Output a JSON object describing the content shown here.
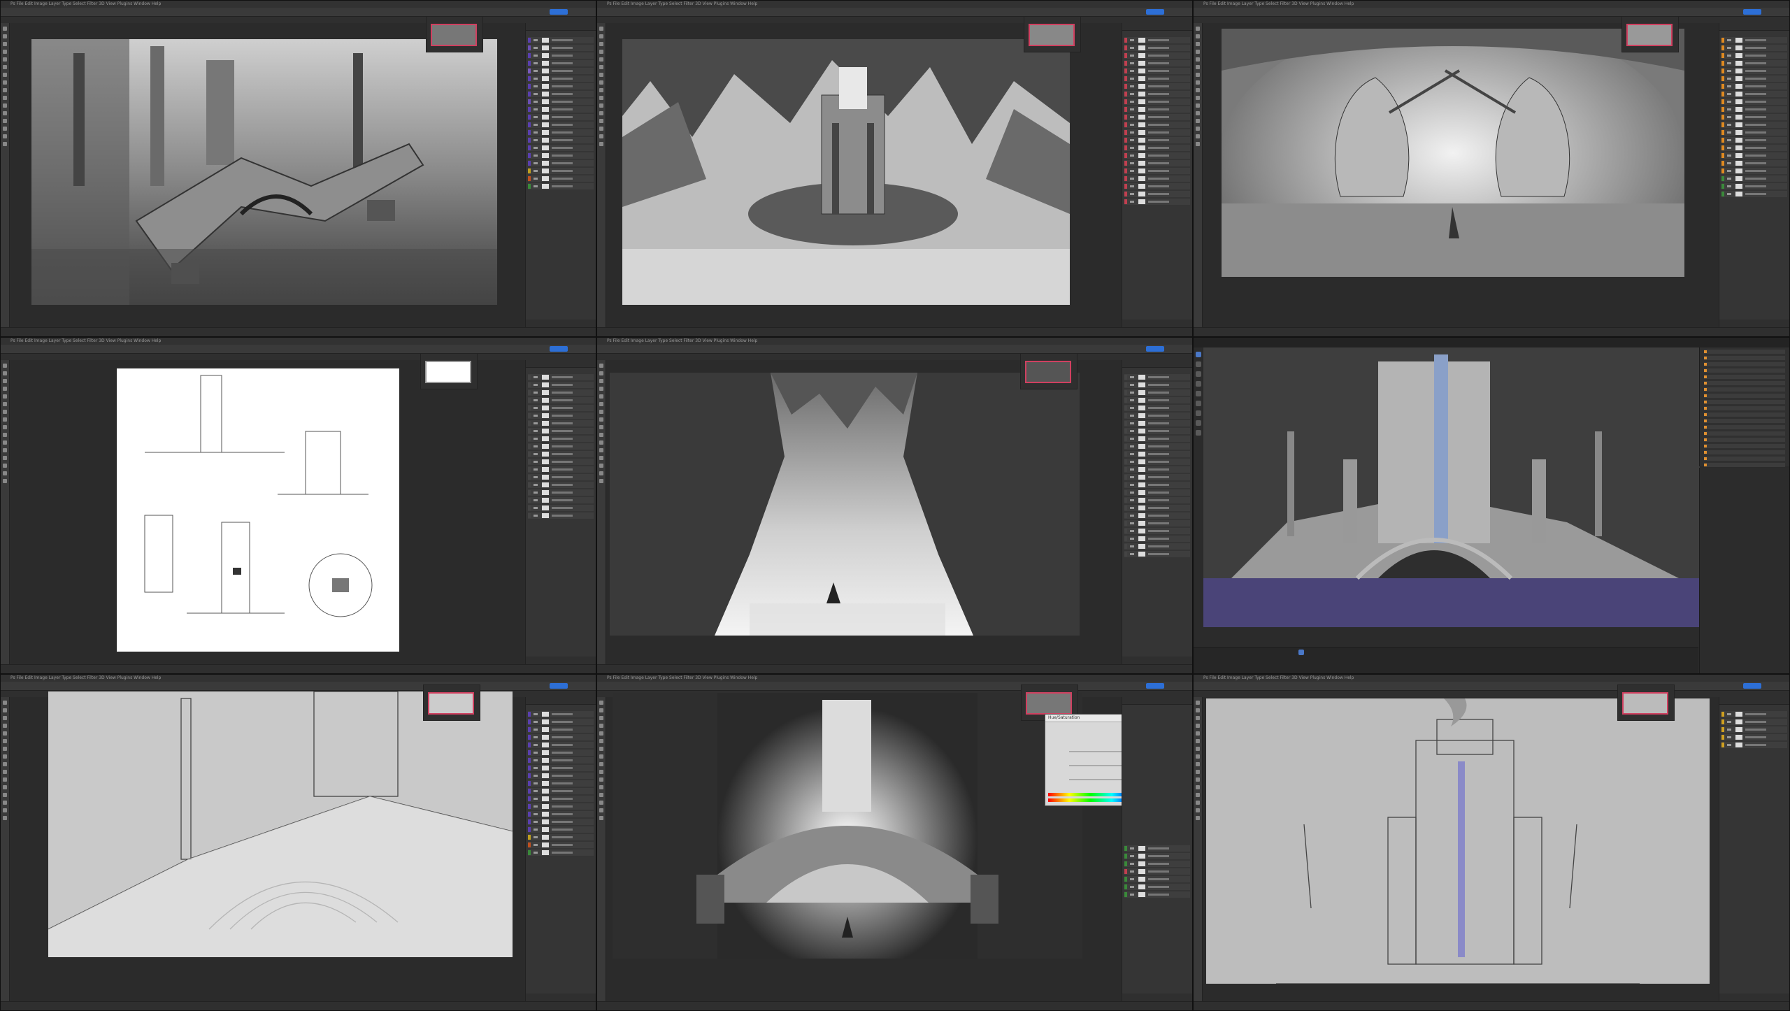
{
  "screenshot": {
    "description_free": true
  },
  "panels": [
    {
      "app": "photoshop",
      "theme_tint": "#6b4fb5",
      "menu": "Ps  File  Edit  Image  Layer  Type  Select  Filter  3D  View  Plugins  Window  Help",
      "swatches": [
        "#5a3fb0",
        "#6b4fb5",
        "#5a3fb0",
        "#5a3fb0",
        "#7a5ac0",
        "#5a3fb0",
        "#5a3fb0",
        "#5a3fb0",
        "#6b4fb5",
        "#5a3fb0",
        "#5a3fb0",
        "#5a3fb0",
        "#5a3fb0",
        "#5a3fb0",
        "#5a3fb0",
        "#5a3fb0",
        "#5a3fb0",
        "#c0a020",
        "#c05020",
        "#3a8a3a"
      ]
    },
    {
      "app": "photoshop",
      "theme_tint": "#c04050",
      "menu": "Ps  File  Edit  Image  Layer  Type  Select  Filter  3D  View  Plugins  Window  Help",
      "swatches": [
        "#c04050",
        "#c04050",
        "#c04050",
        "#c04050",
        "#c04050",
        "#c04050",
        "#c04050",
        "#c04050",
        "#c04050",
        "#c04050",
        "#c04050",
        "#c04050",
        "#c04050",
        "#c04050",
        "#c04050",
        "#c04050",
        "#c04050",
        "#c04050",
        "#c04050",
        "#c04050",
        "#c04050",
        "#c04050"
      ]
    },
    {
      "app": "photoshop",
      "theme_tint": "#e08a20",
      "menu": "Ps  File  Edit  Image  Layer  Type  Select  Filter  3D  View  Plugins  Window  Help",
      "swatches": [
        "#e08a20",
        "#e08a20",
        "#e08a20",
        "#e08a20",
        "#e08a20",
        "#e08a20",
        "#e08a20",
        "#e08a20",
        "#e08a20",
        "#e08a20",
        "#e08a20",
        "#e08a20",
        "#e08a20",
        "#e08a20",
        "#e08a20",
        "#e08a20",
        "#e08a20",
        "#e08a20",
        "#3a8a3a",
        "#3a8a3a",
        "#3a8a3a"
      ]
    },
    {
      "app": "photoshop",
      "theme_tint": "#444",
      "menu": "Ps  File  Edit  Image  Layer  Type  Select  Filter  3D  View  Plugins  Window  Help",
      "swatches": [
        "#444",
        "#444",
        "#444",
        "#444",
        "#444",
        "#444",
        "#444",
        "#444",
        "#444",
        "#444",
        "#444",
        "#444",
        "#444",
        "#444",
        "#444",
        "#444",
        "#444",
        "#444",
        "#444"
      ]
    },
    {
      "app": "photoshop",
      "theme_tint": "#444",
      "menu": "Ps  File  Edit  Image  Layer  Type  Select  Filter  3D  View  Plugins  Window  Help",
      "swatches": [
        "#444",
        "#444",
        "#444",
        "#444",
        "#444",
        "#444",
        "#444",
        "#444",
        "#444",
        "#444",
        "#444",
        "#444",
        "#444",
        "#444",
        "#444",
        "#444",
        "#444",
        "#444",
        "#444",
        "#444",
        "#444",
        "#444",
        "#444",
        "#444"
      ]
    },
    {
      "app": "blender",
      "theme_tint": "#4a78c8"
    },
    {
      "app": "photoshop",
      "theme_tint": "#5a3fb0",
      "menu": "Ps  File  Edit  Image  Layer  Type  Select  Filter  3D  View  Plugins  Window  Help",
      "swatches": [
        "#5a3fb0",
        "#5a3fb0",
        "#5a3fb0",
        "#5a3fb0",
        "#5a3fb0",
        "#5a3fb0",
        "#5a3fb0",
        "#5a3fb0",
        "#5a3fb0",
        "#5a3fb0",
        "#5a3fb0",
        "#5a3fb0",
        "#5a3fb0",
        "#5a3fb0",
        "#5a3fb0",
        "#5a3fb0",
        "#c0a020",
        "#c05020",
        "#3a8a3a"
      ]
    },
    {
      "app": "photoshop",
      "theme_tint": "#3a8a3a",
      "menu": "Ps  File  Edit  Image  Layer  Type  Select  Filter  3D  View  Plugins  Window  Help",
      "dialog_title": "Hue/Saturation",
      "swatches": [
        "#3a8a3a",
        "#3a8a3a",
        "#3a8a3a",
        "#c04050",
        "#3a8a3a",
        "#3a8a3a",
        "#3a8a3a"
      ]
    },
    {
      "app": "photoshop",
      "theme_tint": "#d0a020",
      "menu": "Ps  File  Edit  Image  Layer  Type  Select  Filter  3D  View  Plugins  Window  Help",
      "swatches": [
        "#d0a020",
        "#d0a020",
        "#d0a020",
        "#d0a020",
        "#d0a020"
      ]
    }
  ],
  "colors": {
    "app_bg": "#2b2b2b",
    "accent_blue": "#2d6fd6",
    "nav_frame": "#d04060",
    "water_purple": "#4a4478"
  }
}
